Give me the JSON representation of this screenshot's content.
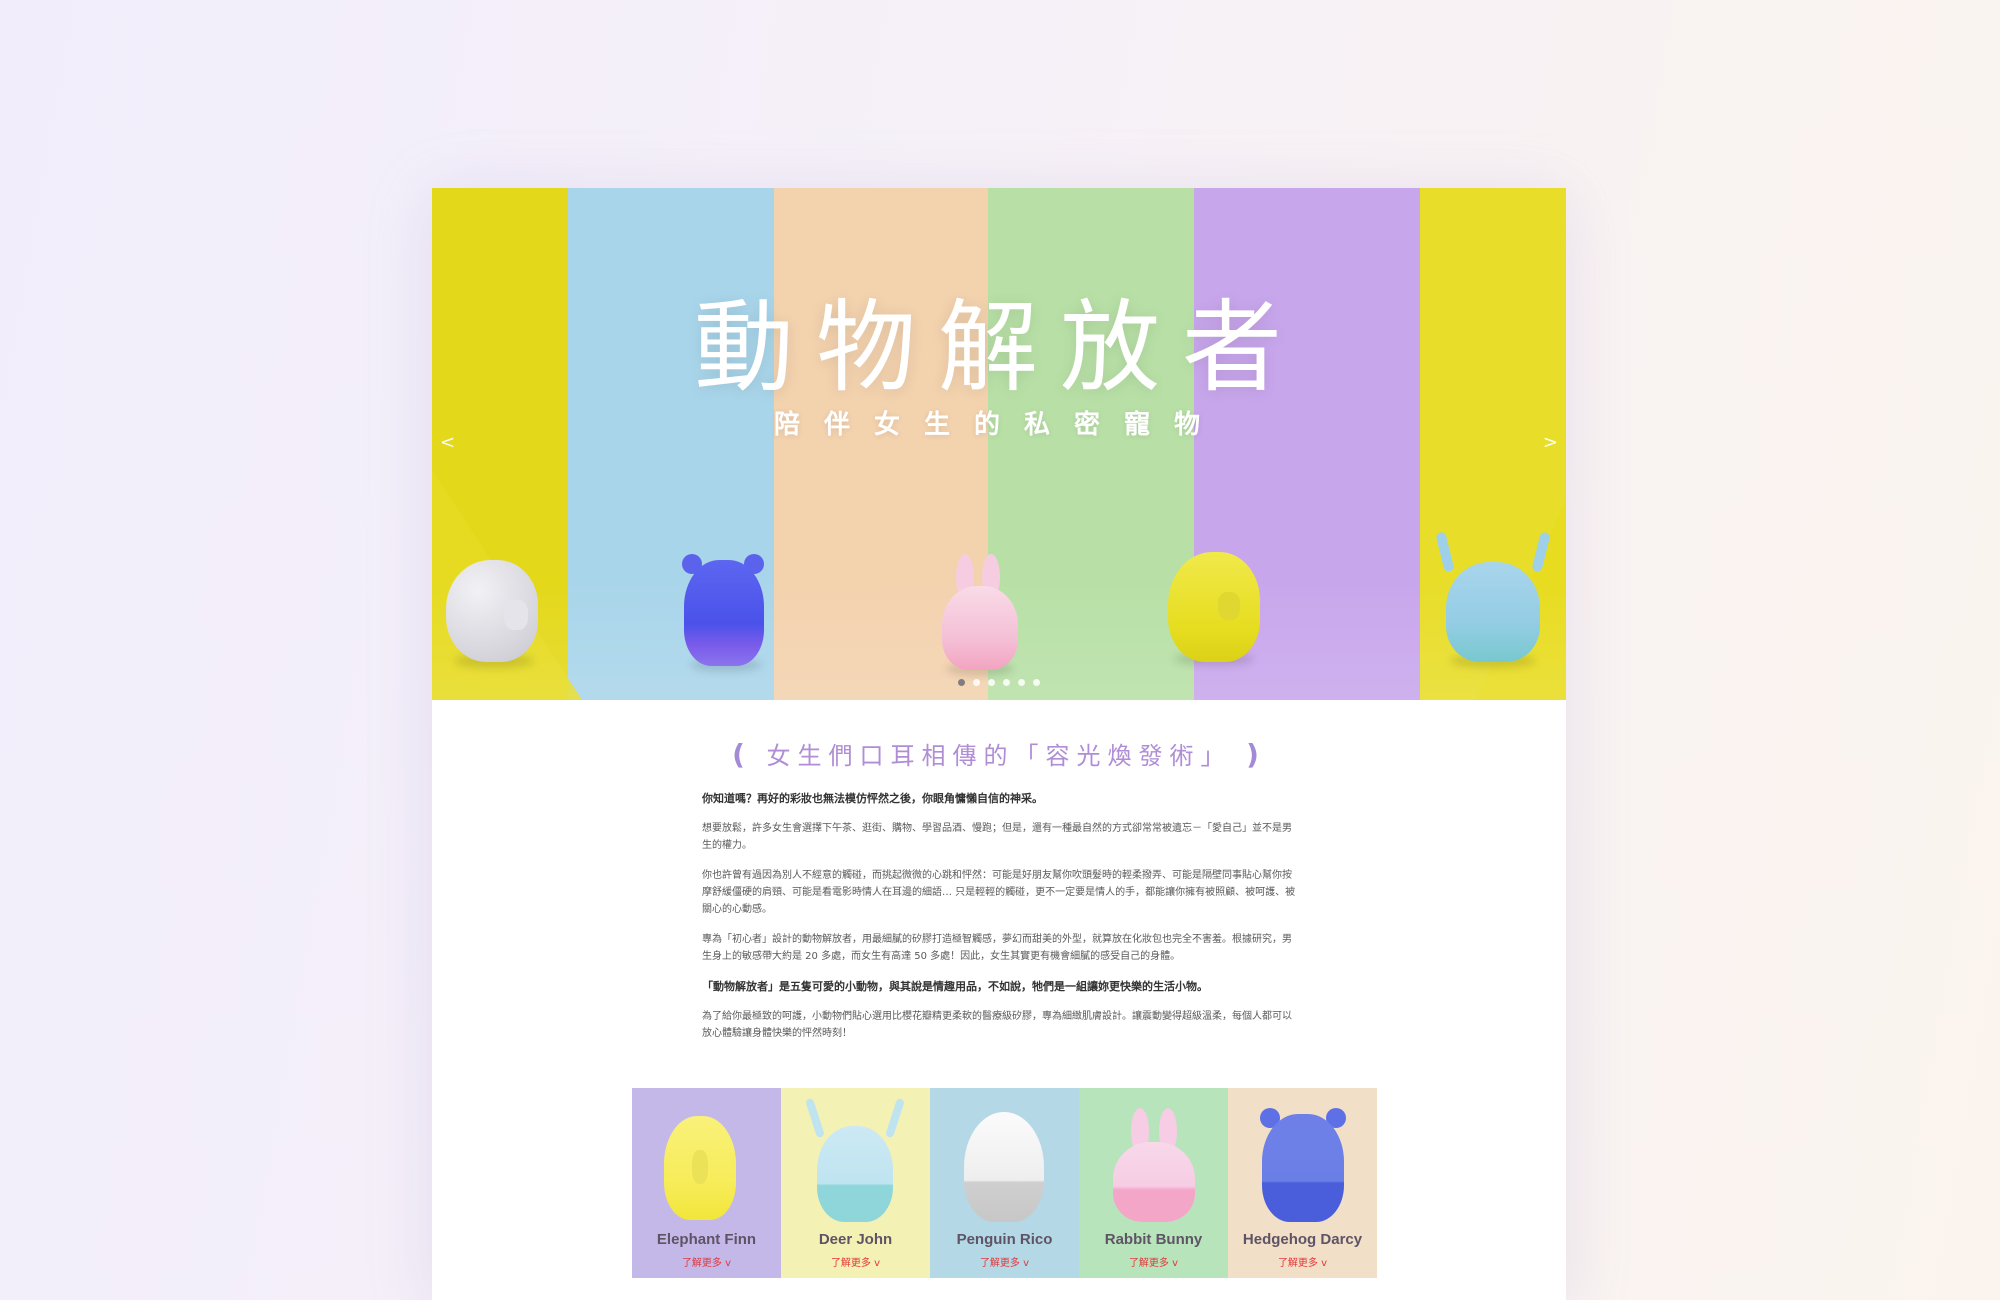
{
  "hero": {
    "title": "動物解放者",
    "subtitle": "陪伴女生的私密寵物",
    "prev_arrow": "<",
    "next_arrow": ">",
    "slide_count": 6,
    "active_slide": 1,
    "colors": {
      "yellow": "#e4d81a",
      "blue": "#a9d5ea",
      "peach": "#f3d2ae",
      "green": "#b8e0a6",
      "purple": "#c8a6ec"
    }
  },
  "intro": {
    "heading": "女生們口耳相傳的「容光煥發術」",
    "brace_open": "(",
    "brace_close": ")",
    "paragraphs": [
      "你知道嗎？再好的彩妝也無法模仿怦然之後，你眼角慵懶自信的神采。",
      "想要放鬆，許多女生會選擇下午茶、逛街、購物、學習品酒、慢跑；但是，還有一種最自然的方式卻常常被遺忘－「愛自己」並不是男生的權力。",
      "你也許曾有過因為別人不經意的觸碰，而挑起微微的心跳和怦然：可能是好朋友幫你吹頭髮時的輕柔撥弄、可能是隔壁同事貼心幫你按摩舒緩僵硬的肩頸、可能是看電影時情人在耳邊的細語… 只是輕輕的觸碰，更不一定要是情人的手，都能讓你擁有被照顧、被呵護、被關心的心動感。",
      "專為「初心者」設計的動物解放者，用最細膩的矽膠打造極智觸感，夢幻而甜美的外型，就算放在化妝包也完全不害羞。根據研究，男生身上的敏感帶大約是 20 多處，而女生有高達 50 多處！因此，女生其實更有機會細膩的感受自己的身體。",
      "「動物解放者」是五隻可愛的小動物，與其說是情趣用品，不如說，牠們是一組讓妳更快樂的生活小物。",
      "為了給你最極致的呵護，小動物們貼心選用比櫻花瓣精更柔軟的醫療級矽膠，專為細緻肌膚設計。讓震動變得超級溫柔，每個人都可以放心體驗讓身體快樂的怦然時刻！"
    ]
  },
  "products": [
    {
      "name": "Elephant Finn",
      "more": "了解更多",
      "bg": "#c4b8e8",
      "toy": "#f7ee6c",
      "toy_bottom": "#f2e63c"
    },
    {
      "name": "Deer John",
      "more": "了解更多",
      "bg": "#f4f1b4",
      "toy": "#bfe4f0",
      "toy_bottom": "#8fd6db"
    },
    {
      "name": "Penguin Rico",
      "more": "了解更多",
      "bg": "#b4d8e6",
      "toy": "#f3f3f3",
      "toy_bottom": "#cfcfcf"
    },
    {
      "name": "Rabbit Bunny",
      "more": "了解更多",
      "bg": "#b8e4bc",
      "toy": "#f6cde4",
      "toy_bottom": "#f4a6c8"
    },
    {
      "name": "Hedgehog Darcy",
      "more": "了解更多",
      "bg": "#f2dfc7",
      "toy": "#6a7fe6",
      "toy_bottom": "#4a5edc"
    }
  ],
  "more_chevron": "v"
}
